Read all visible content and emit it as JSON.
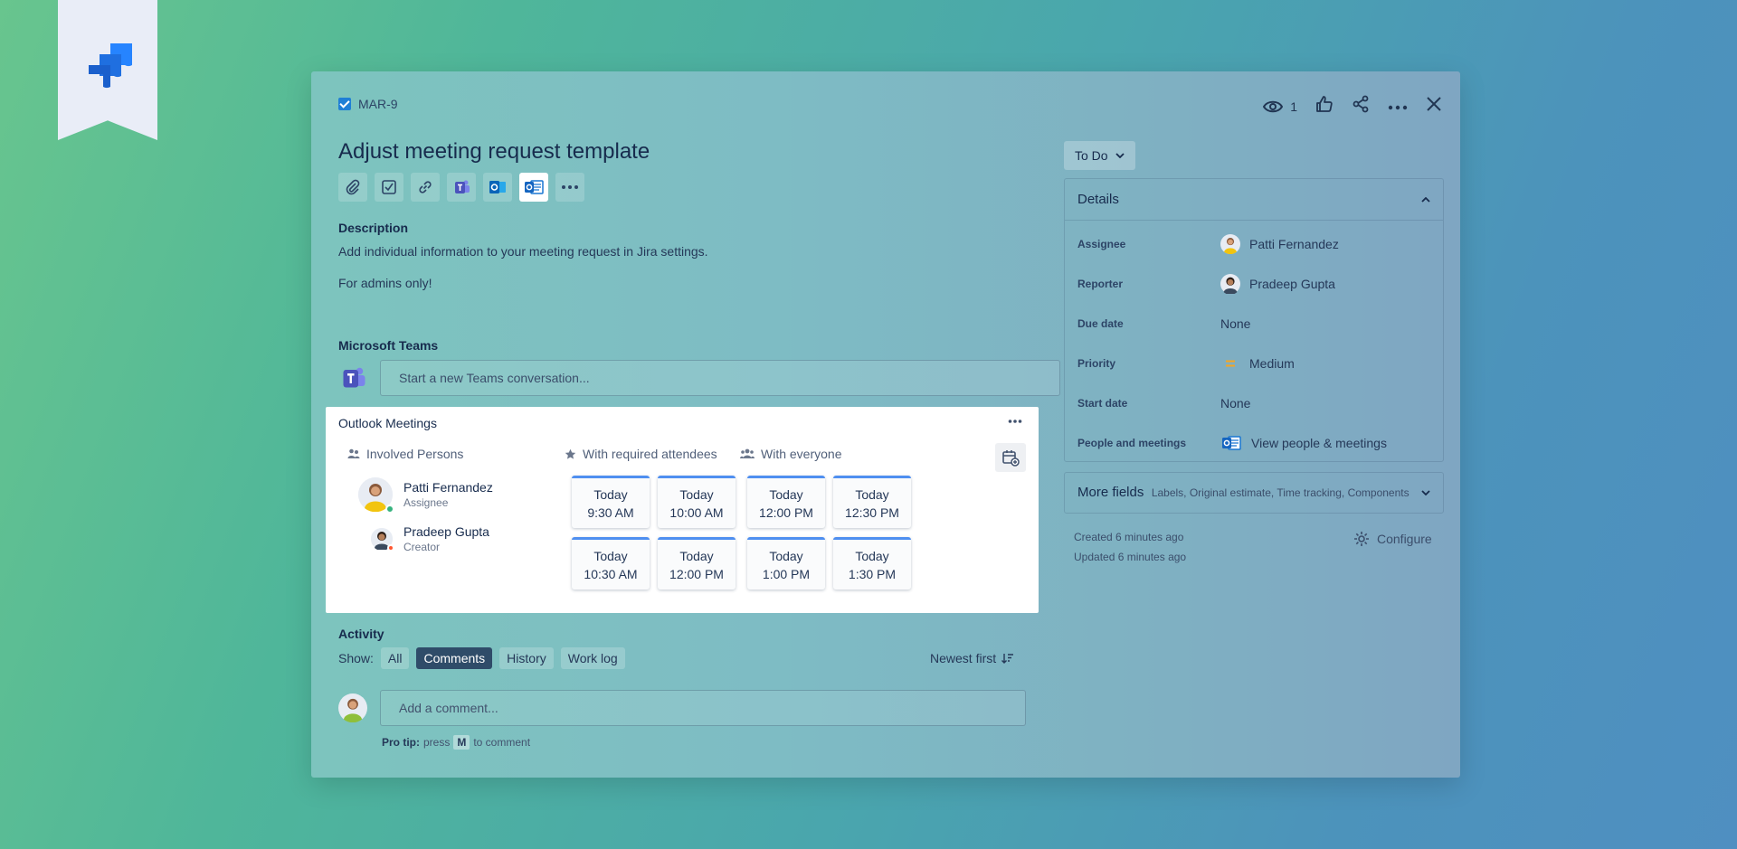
{
  "issue": {
    "key": "MAR-9",
    "title": "Adjust meeting request template",
    "watchers": "1"
  },
  "description": {
    "label": "Description",
    "line1": "Add individual information to your meeting request in Jira settings.",
    "line2": "For admins only!"
  },
  "teams": {
    "label": "Microsoft Teams",
    "placeholder": "Start a new Teams conversation..."
  },
  "outlook": {
    "title": "Outlook Meetings",
    "involved_label": "Involved Persons",
    "required_label": "With required attendees",
    "everyone_label": "With everyone",
    "persons": [
      {
        "name": "Patti Fernandez",
        "role": "Assignee"
      },
      {
        "name": "Pradeep Gupta",
        "role": "Creator"
      }
    ],
    "slots": [
      {
        "day": "Today",
        "time": "9:30 AM"
      },
      {
        "day": "Today",
        "time": "10:00 AM"
      },
      {
        "day": "Today",
        "time": "12:00 PM"
      },
      {
        "day": "Today",
        "time": "12:30 PM"
      },
      {
        "day": "Today",
        "time": "10:30 AM"
      },
      {
        "day": "Today",
        "time": "12:00 PM"
      },
      {
        "day": "Today",
        "time": "1:00 PM"
      },
      {
        "day": "Today",
        "time": "1:30 PM"
      }
    ]
  },
  "activity": {
    "label": "Activity",
    "show_label": "Show:",
    "filters": [
      "All",
      "Comments",
      "History",
      "Work log"
    ],
    "sort_label": "Newest first",
    "comment_placeholder": "Add a comment...",
    "protip_bold": "Pro tip:",
    "protip_pre": "press",
    "protip_key": "M",
    "protip_post": "to comment"
  },
  "sidebar": {
    "status": "To Do",
    "details_title": "Details",
    "rows": [
      {
        "label": "Assignee",
        "value": "Patti Fernandez"
      },
      {
        "label": "Reporter",
        "value": "Pradeep Gupta"
      },
      {
        "label": "Due date",
        "value": "None"
      },
      {
        "label": "Priority",
        "value": "Medium"
      },
      {
        "label": "Start date",
        "value": "None"
      },
      {
        "label": "People and meetings",
        "value": "View people & meetings"
      }
    ],
    "more_fields_title": "More fields",
    "more_fields_list": "Labels, Original estimate, Time tracking, Components",
    "created": "Created 6 minutes ago",
    "updated": "Updated 6 minutes ago",
    "configure": "Configure"
  },
  "colors": {
    "accent": "#4f8ff0",
    "online": "#36b37e",
    "busy": "#ff5630",
    "priority_medium": "#f5a623"
  }
}
